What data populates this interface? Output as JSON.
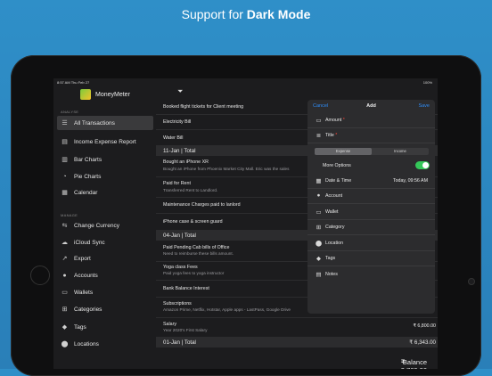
{
  "headline": {
    "prefix": "Support for",
    "bold": "Dark Mode"
  },
  "status_bar": {
    "time": "8:57 AM Thu Feb 27",
    "battery": "100%"
  },
  "sidebar": {
    "app_name": "MoneyMeter",
    "sections": [
      {
        "title": "ANALYSE",
        "items": [
          {
            "label": "All Transactions",
            "icon": "list-icon",
            "selected": true
          },
          {
            "label": "Income Expense Report",
            "icon": "report-icon"
          },
          {
            "label": "Bar Charts",
            "icon": "bar-chart-icon"
          },
          {
            "label": "Pie Charts",
            "icon": "pie-chart-icon"
          },
          {
            "label": "Calendar",
            "icon": "calendar-icon"
          }
        ]
      },
      {
        "title": "MANAGE",
        "items": [
          {
            "label": "Change Currency",
            "icon": "currency-icon"
          },
          {
            "label": "iCloud Sync",
            "icon": "cloud-icon"
          },
          {
            "label": "Export",
            "icon": "export-icon"
          },
          {
            "label": "Accounts",
            "icon": "accounts-icon"
          },
          {
            "label": "Wallets",
            "icon": "wallet-icon"
          },
          {
            "label": "Categories",
            "icon": "categories-icon"
          },
          {
            "label": "Tags",
            "icon": "tag-icon"
          },
          {
            "label": "Locations",
            "icon": "location-icon"
          }
        ]
      }
    ]
  },
  "transactions": [
    {
      "kind": "row",
      "title": "Booked flight tickets for Client meeting",
      "sub": "",
      "amount": ""
    },
    {
      "kind": "row",
      "title": "Electricity Bill",
      "sub": "",
      "amount": ""
    },
    {
      "kind": "row",
      "title": "Water Bill",
      "sub": "",
      "amount": ""
    },
    {
      "kind": "header",
      "title": "11-Jan | Total",
      "amount": ""
    },
    {
      "kind": "row",
      "title": "Bought an iPhone XR",
      "sub": "Bought an iPhone from Phoenix Market City Mall. Eric was the sales",
      "amount": ""
    },
    {
      "kind": "row",
      "title": "Paid for Rent",
      "sub": "Transferred Rent to Landlord.",
      "amount": ""
    },
    {
      "kind": "row",
      "title": "Maintenance Charges paid to lanlord",
      "sub": "",
      "amount": ""
    },
    {
      "kind": "row",
      "title": "iPhone case & screen guard",
      "sub": "",
      "amount": ""
    },
    {
      "kind": "header",
      "title": "04-Jan | Total",
      "amount": ""
    },
    {
      "kind": "row",
      "title": "Paid Pending Cab bills of Office",
      "sub": "Need to reimburse these bills amount.",
      "amount": ""
    },
    {
      "kind": "row",
      "title": "Yoga class Fees",
      "sub": "Paid yoga fees to yoga instructor",
      "amount": ""
    },
    {
      "kind": "row",
      "title": "Bank Balance Interest",
      "sub": "",
      "amount": ""
    },
    {
      "kind": "row",
      "title": "Subscriptions",
      "sub": "Amazon Prime, Netflix, Hotstar, Apple apps - LastPass, Google Drive",
      "amount": ""
    },
    {
      "kind": "row",
      "title": "Salary",
      "sub": "Year 2020's First Salary",
      "amount": "₹ 6,800.00"
    },
    {
      "kind": "header",
      "title": "01-Jan | Total",
      "amount": "₹ 6,343.00"
    }
  ],
  "balance": {
    "label": "Balance",
    "amount": "₹ 2,769.00"
  },
  "add_modal": {
    "cancel": "Cancel",
    "title": "Add",
    "save": "Save",
    "amount_label": "Amount",
    "title_label": "Title",
    "required_mark": "*",
    "segment": [
      "Expense",
      "Income"
    ],
    "more_options": "More Options",
    "datetime_label": "Date & Time",
    "datetime_value": "Today, 09:56 AM",
    "fields": [
      "Account",
      "Wallet",
      "Category",
      "Location",
      "Tags",
      "Notes"
    ]
  },
  "colors": {
    "accent": "#2f8cf6",
    "toggle_on": "#34c759",
    "background": "#2b86c0"
  }
}
